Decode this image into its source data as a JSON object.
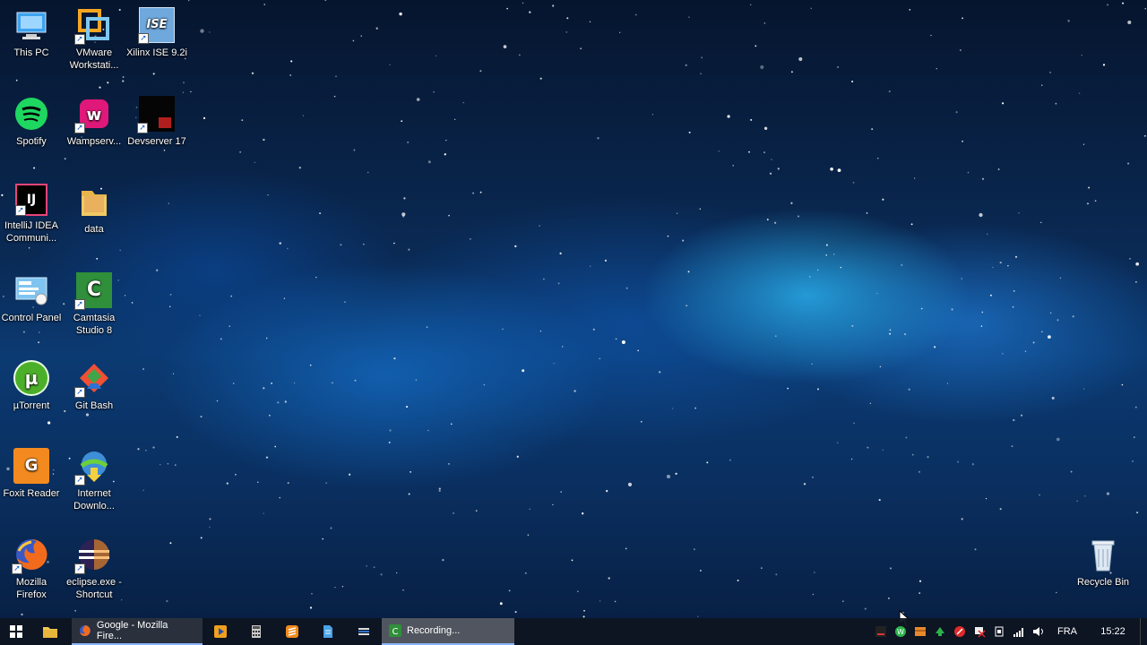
{
  "desktop": {
    "icons": [
      {
        "name": "this-pc",
        "label": "This PC",
        "icon": "computer-icon"
      },
      {
        "name": "vmware",
        "label": "VMware Workstati...",
        "icon": "vmware-icon"
      },
      {
        "name": "xilinx",
        "label": "Xilinx ISE 9.2i",
        "icon": "xilinx-icon",
        "glyph": "ISE"
      },
      {
        "name": "spotify",
        "label": "Spotify",
        "icon": "spotify-icon"
      },
      {
        "name": "wampserver",
        "label": "Wampserv...",
        "icon": "wampserver-icon"
      },
      {
        "name": "devserver",
        "label": "Devserver 17",
        "icon": "devserver-icon"
      },
      {
        "name": "intellij",
        "label": "IntelliJ IDEA Communi...",
        "icon": "intellij-icon",
        "glyph": "IJ"
      },
      {
        "name": "data",
        "label": "data",
        "icon": "folder-icon"
      },
      {
        "name": "control-panel",
        "label": "Control Panel",
        "icon": "control-panel-icon"
      },
      {
        "name": "camtasia",
        "label": "Camtasia Studio 8",
        "icon": "camtasia-icon",
        "glyph": "C"
      },
      {
        "name": "utorrent",
        "label": "µTorrent",
        "icon": "utorrent-icon",
        "glyph": "µ"
      },
      {
        "name": "git-bash",
        "label": "Git Bash",
        "icon": "git-icon"
      },
      {
        "name": "foxit",
        "label": "Foxit Reader",
        "icon": "foxit-icon",
        "glyph": "G"
      },
      {
        "name": "idm",
        "label": "Internet Downlo...",
        "icon": "idm-icon"
      },
      {
        "name": "firefox",
        "label": "Mozilla Firefox",
        "icon": "firefox-icon"
      },
      {
        "name": "eclipse",
        "label": "eclipse.exe - Shortcut",
        "icon": "eclipse-icon"
      },
      {
        "name": "recycle-bin",
        "label": "Recycle Bin",
        "icon": "recycle-bin-icon"
      }
    ]
  },
  "taskbar": {
    "firefox_task": "Google - Mozilla Fire...",
    "recording_task": "Recording...",
    "language": "FRA",
    "time": "15:22"
  },
  "colors": {
    "taskbar": "#0e1420",
    "accent": "#8ab4f8"
  }
}
